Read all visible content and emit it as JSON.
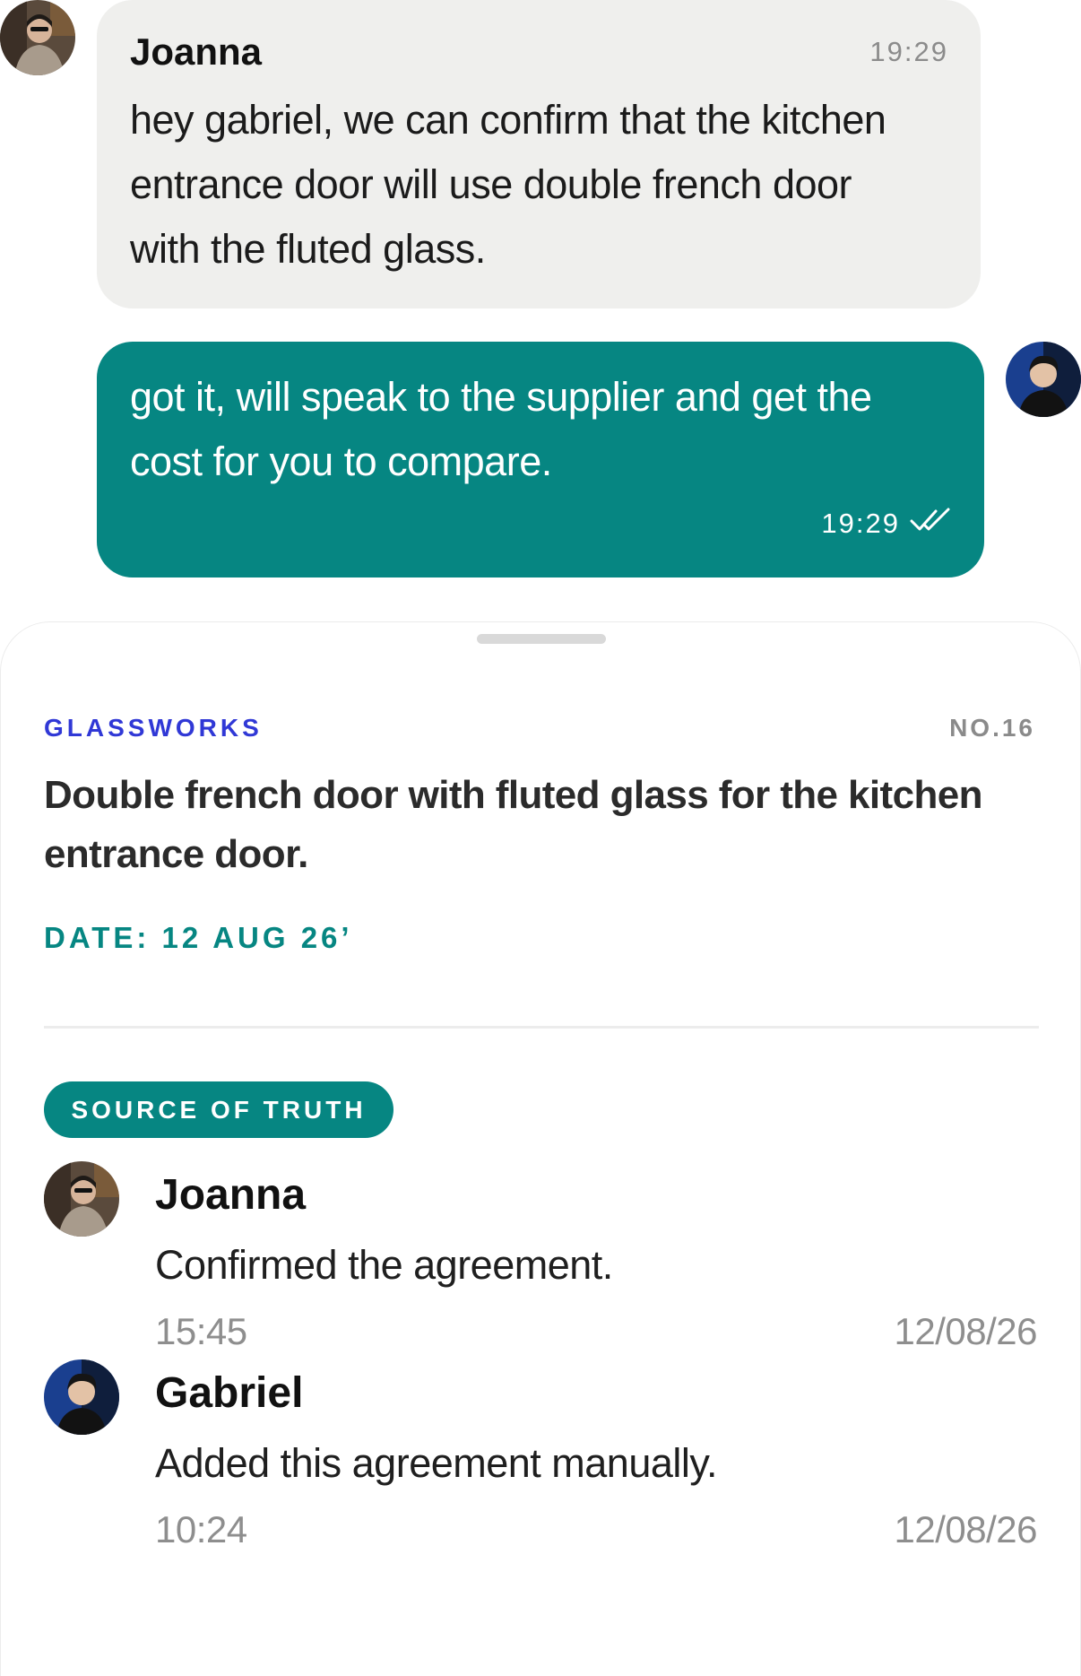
{
  "chat": {
    "incoming": {
      "sender": "Joanna",
      "time": "19:29",
      "text": "hey gabriel, we can confirm that the kitchen entrance door will use double french door with the fluted glass."
    },
    "outgoing": {
      "text": "got it, will speak to the supplier and get the cost for you to compare.",
      "time": "19:29",
      "status_icon": "double-check-icon"
    }
  },
  "agreement": {
    "vendor": "GLASSWORKS",
    "number": "NO.16",
    "title": "Double french door with fluted glass for the kitchen entrance door.",
    "date": "DATE: 12 AUG 26’",
    "badge": "SOURCE OF TRUTH",
    "entries": [
      {
        "name": "Joanna",
        "description": "Confirmed the agreement.",
        "time": "15:45",
        "date": "12/08/26"
      },
      {
        "name": "Gabriel",
        "description": "Added this agreement manually.",
        "time": "10:24",
        "date": "12/08/26"
      }
    ]
  },
  "colors": {
    "accent": "#068682",
    "vendor_blue": "#3038d6",
    "incoming_bubble": "#efefed",
    "muted_text": "#8e8e8e"
  }
}
